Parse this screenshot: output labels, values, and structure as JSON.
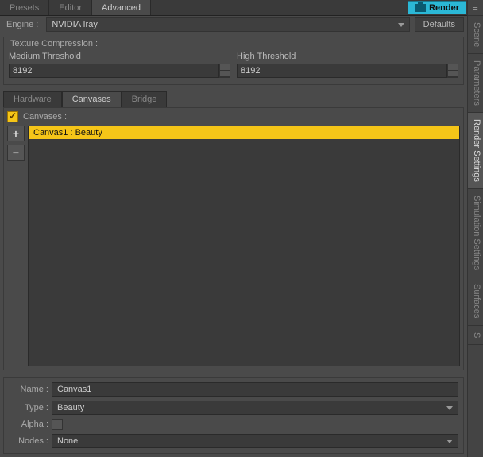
{
  "topbar": {
    "tabs": [
      "Presets",
      "Editor",
      "Advanced"
    ],
    "render_label": "Render"
  },
  "engine": {
    "label": "Engine :",
    "value": "NVIDIA Iray",
    "defaults_label": "Defaults"
  },
  "texcomp": {
    "title": "Texture Compression :",
    "medium_label": "Medium Threshold",
    "medium_value": "8192",
    "high_label": "High Threshold",
    "high_value": "8192"
  },
  "subtabs": [
    "Hardware",
    "Canvases",
    "Bridge"
  ],
  "canvases": {
    "header": "Canvases :",
    "items": [
      "Canvas1 : Beauty"
    ]
  },
  "props": {
    "name_label": "Name :",
    "name_value": "Canvas1",
    "type_label": "Type :",
    "type_value": "Beauty",
    "alpha_label": "Alpha :",
    "nodes_label": "Nodes :",
    "nodes_value": "None"
  },
  "sidetabs": [
    "Scene",
    "Parameters",
    "Render Settings",
    "Simulation Settings",
    "Surfaces",
    "S"
  ]
}
